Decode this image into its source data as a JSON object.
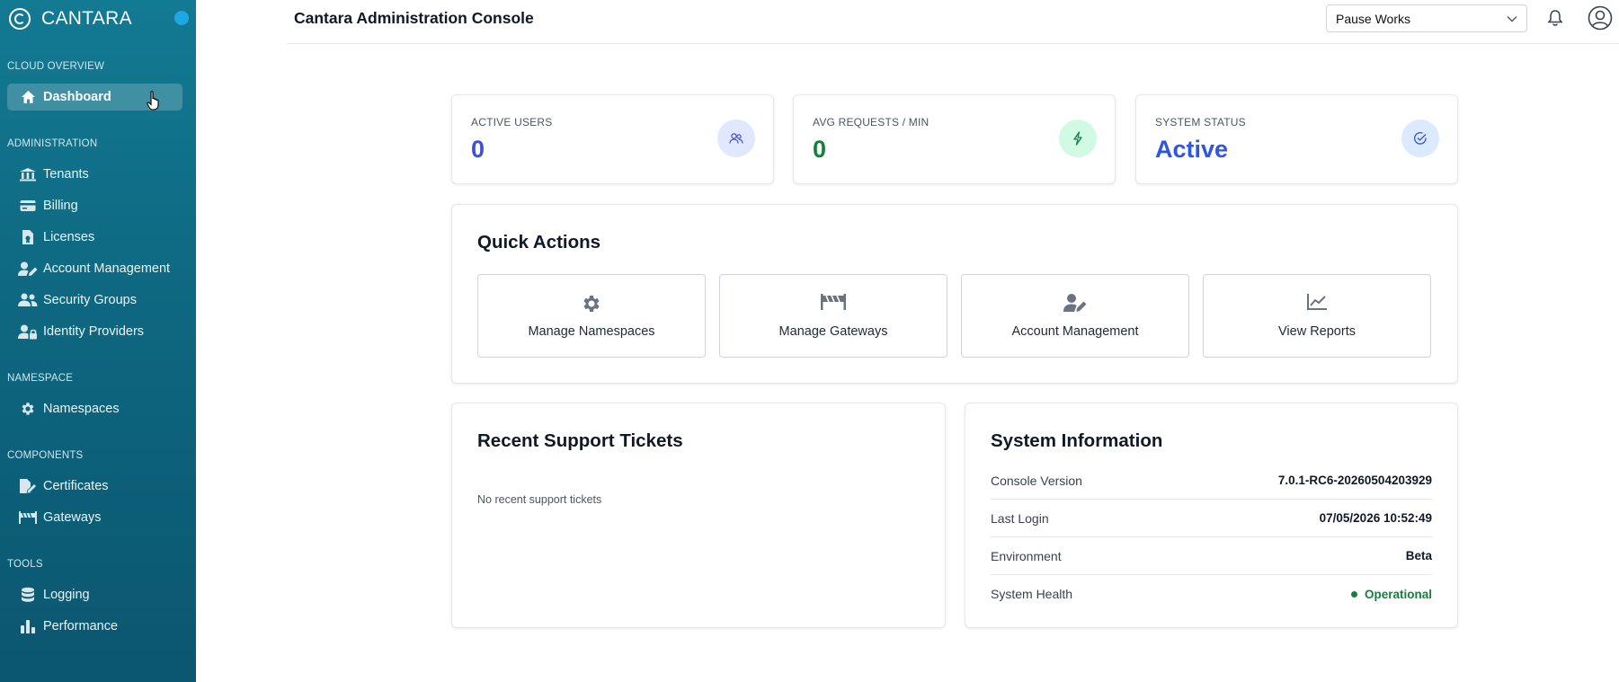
{
  "app": {
    "brand": "CANTARA",
    "title": "Cantara Administration Console"
  },
  "header": {
    "tenant_selected": "Pause Works"
  },
  "sidebar": {
    "sections": [
      {
        "title": "CLOUD OVERVIEW",
        "items": [
          {
            "label": "Dashboard",
            "icon": "home-icon",
            "active": true
          }
        ]
      },
      {
        "title": "ADMINISTRATION",
        "items": [
          {
            "label": "Tenants",
            "icon": "building-icon"
          },
          {
            "label": "Billing",
            "icon": "credit-card-icon"
          },
          {
            "label": "Licenses",
            "icon": "license-icon"
          },
          {
            "label": "Account Management",
            "icon": "user-edit-icon"
          },
          {
            "label": "Security Groups",
            "icon": "users-icon"
          },
          {
            "label": "Identity Providers",
            "icon": "user-lock-icon"
          }
        ]
      },
      {
        "title": "NAMESPACE",
        "items": [
          {
            "label": "Namespaces",
            "icon": "gear-icon"
          }
        ]
      },
      {
        "title": "COMPONENTS",
        "items": [
          {
            "label": "Certificates",
            "icon": "certificate-icon"
          },
          {
            "label": "Gateways",
            "icon": "gateway-icon"
          }
        ]
      },
      {
        "title": "TOOLS",
        "items": [
          {
            "label": "Logging",
            "icon": "database-icon"
          },
          {
            "label": "Performance",
            "icon": "bar-chart-icon"
          }
        ]
      }
    ]
  },
  "stats": [
    {
      "label": "ACTIVE USERS",
      "value": "0",
      "icon": "users-icon",
      "color": "#3b4fd8"
    },
    {
      "label": "AVG REQUESTS / MIN",
      "value": "0",
      "icon": "bolt-icon",
      "color": "#15803d"
    },
    {
      "label": "SYSTEM STATUS",
      "value": "Active",
      "icon": "check-circle-icon",
      "color": "#2f55e4"
    }
  ],
  "quick_actions": {
    "title": "Quick Actions",
    "items": [
      {
        "label": "Manage Namespaces",
        "icon": "gear-icon"
      },
      {
        "label": "Manage Gateways",
        "icon": "gateway-icon"
      },
      {
        "label": "Account Management",
        "icon": "user-edit-icon"
      },
      {
        "label": "View Reports",
        "icon": "line-chart-icon"
      }
    ]
  },
  "support": {
    "title": "Recent Support Tickets",
    "empty_message": "No recent support tickets"
  },
  "system_info": {
    "title": "System Information",
    "rows": [
      {
        "key": "Console Version",
        "value": "7.0.1-RC6-20260504203929"
      },
      {
        "key": "Last Login",
        "value": "07/05/2026 10:52:49"
      },
      {
        "key": "Environment",
        "value": "Beta"
      },
      {
        "key": "System Health",
        "value": "Operational"
      }
    ]
  }
}
